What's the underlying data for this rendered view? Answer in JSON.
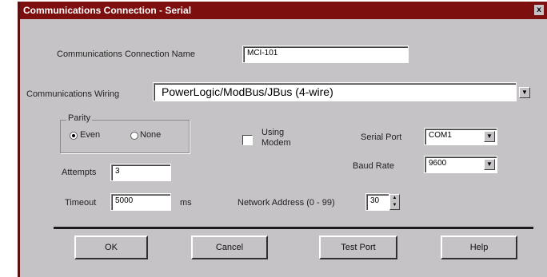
{
  "dialog": {
    "title": "Communications Connection - Serial",
    "close_label": "x"
  },
  "connection_name": {
    "label": "Communications Connection Name",
    "value": "MCI-101"
  },
  "wiring": {
    "label": "Communications Wiring",
    "value": "PowerLogic/ModBus/JBus (4-wire)"
  },
  "parity": {
    "group_label": "Parity",
    "even_label": "Even",
    "none_label": "None",
    "selected": "Even"
  },
  "modem": {
    "label_line1": "Using",
    "label_line2": "Modem",
    "checked": false
  },
  "serial_port": {
    "label": "Serial Port",
    "value": "COM1"
  },
  "baud_rate": {
    "label": "Baud Rate",
    "value": "9600"
  },
  "attempts": {
    "label": "Attempts",
    "value": "3"
  },
  "timeout": {
    "label": "Timeout",
    "value": "5000",
    "unit": "ms"
  },
  "network_address": {
    "label": "Network Address (0 - 99)",
    "value": "30"
  },
  "buttons": {
    "ok": "OK",
    "cancel": "Cancel",
    "test_port": "Test Port",
    "help": "Help"
  },
  "colors": {
    "titlebar": "#7d0f0f",
    "dialog_bg": "#c6c3c6"
  },
  "icons": {
    "dropdown": "chevron-down-icon",
    "spin": "spin-arrows-icon",
    "close": "close-icon"
  }
}
